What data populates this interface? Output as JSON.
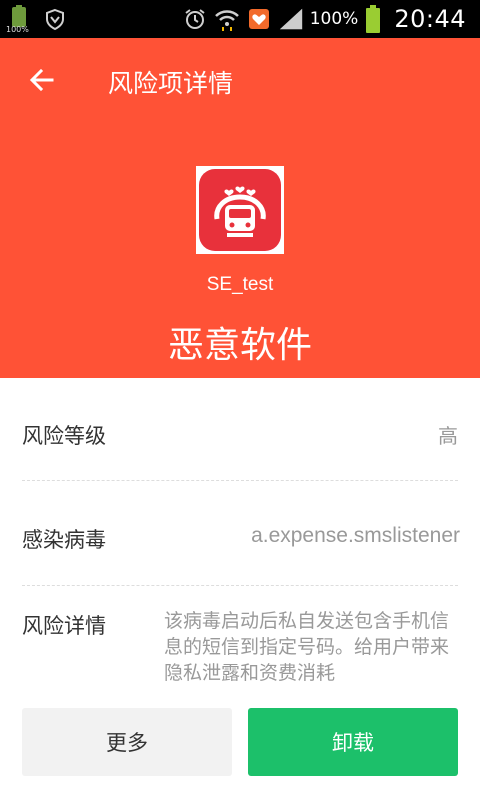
{
  "status_bar": {
    "small_battery_pct": "100%",
    "battery_pct": "100%",
    "time": "20:44",
    "icons": [
      "battery-small-icon",
      "shield-icon",
      "alarm-icon",
      "wifi-icon",
      "notification-app-icon",
      "signal-icon",
      "battery-icon"
    ]
  },
  "header": {
    "title": "风险项详情",
    "app_name": "SE_test",
    "risk_type": "恶意软件",
    "color": "#ff5236"
  },
  "details": {
    "level_label": "风险等级",
    "level_value": "高",
    "virus_label": "感染病毒",
    "virus_value": "a.expense.smslistener",
    "detail_label": "风险详情",
    "detail_text": "该病毒启动后私自发送包含手机信息的短信到指定号码。给用户带来隐私泄露和资费消耗"
  },
  "actions": {
    "more_label": "更多",
    "uninstall_label": "卸载",
    "uninstall_color": "#1cc06a"
  }
}
